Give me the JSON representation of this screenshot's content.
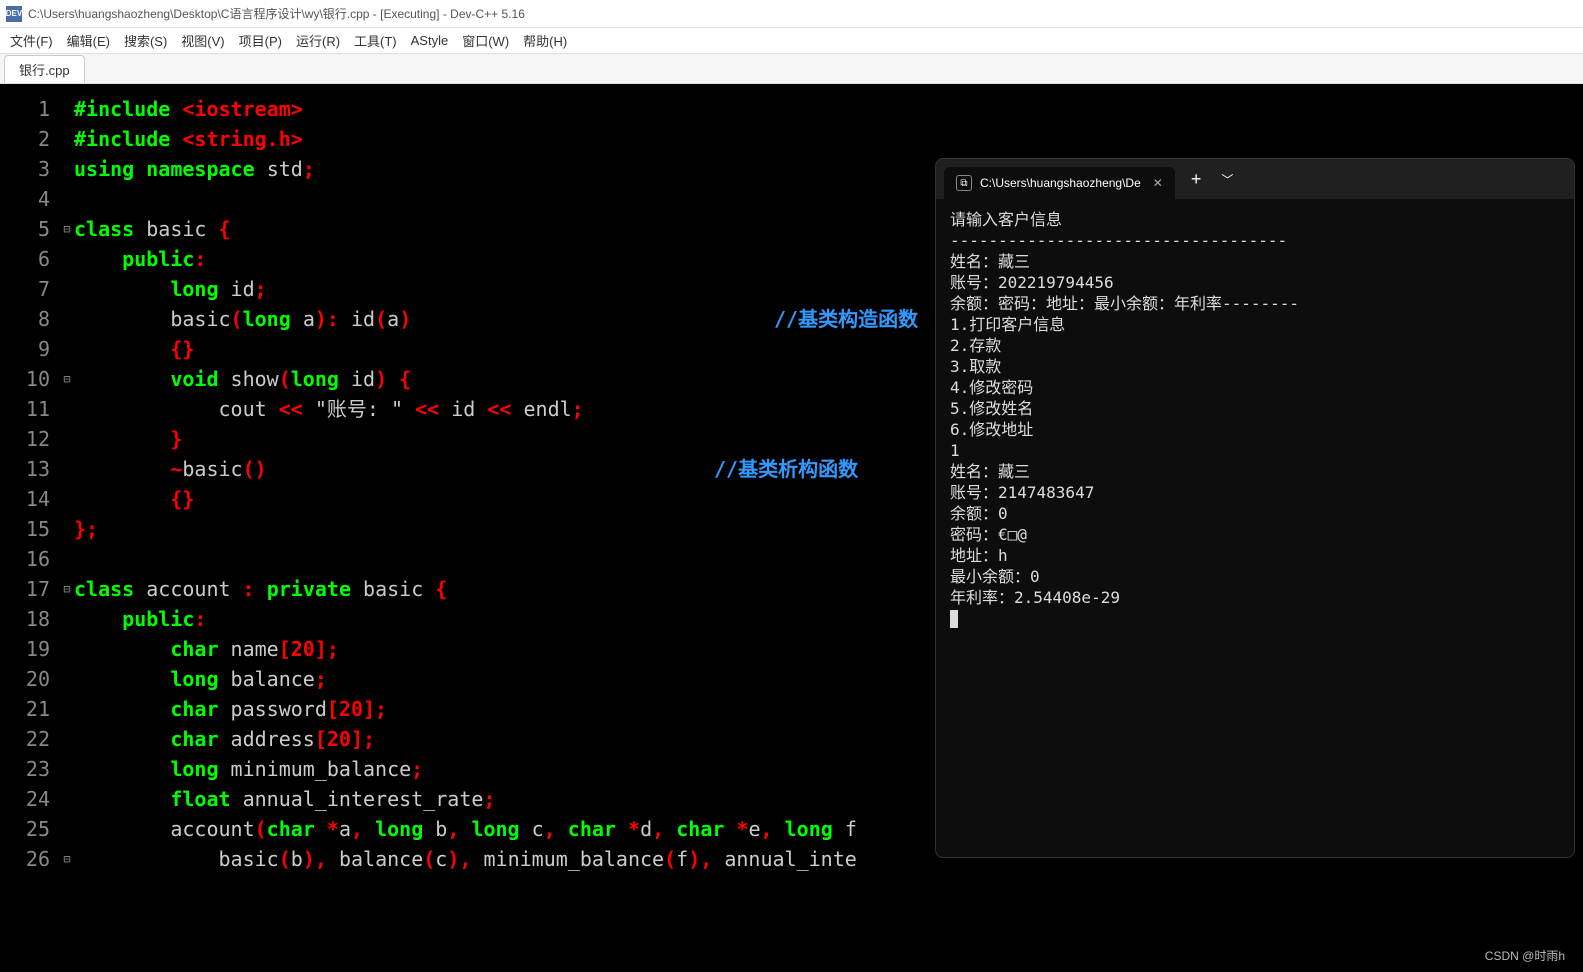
{
  "window": {
    "title": "C:\\Users\\huangshaozheng\\Desktop\\C语言程序设计\\wy\\银行.cpp - [Executing] - Dev-C++ 5.16",
    "app_icon_text": "DEV"
  },
  "menu": {
    "file": "文件(F)",
    "edit": "编辑(E)",
    "search": "搜索(S)",
    "view": "视图(V)",
    "project": "项目(P)",
    "run": "运行(R)",
    "tools": "工具(T)",
    "astyle": "AStyle",
    "window": "窗口(W)",
    "help": "帮助(H)"
  },
  "tab": {
    "label": "银行.cpp"
  },
  "code": {
    "lines": [
      {
        "n": 1,
        "fold": "",
        "html": "<span class='pp'>#include</span> <span class='incl'>&lt;iostream&gt;</span>"
      },
      {
        "n": 2,
        "fold": "",
        "html": "<span class='pp'>#include</span> <span class='incl'>&lt;string.h&gt;</span>"
      },
      {
        "n": 3,
        "fold": "",
        "html": "<span class='kw'>using</span> <span class='kw'>namespace</span> <span class='ident'>std</span><span class='punct'>;</span>"
      },
      {
        "n": 4,
        "fold": "",
        "html": ""
      },
      {
        "n": 5,
        "fold": "⊟",
        "html": "<span class='kw'>class</span> <span class='ident'>basic</span> <span class='punct'>{</span>"
      },
      {
        "n": 6,
        "fold": "",
        "html": "    <span class='kw'>public</span><span class='punct'>:</span>"
      },
      {
        "n": 7,
        "fold": "",
        "html": "        <span class='type'>long</span> <span class='ident'>id</span><span class='punct'>;</span>"
      },
      {
        "n": 8,
        "fold": "",
        "html": "        <span class='func'>basic</span><span class='punct'>(</span><span class='type'>long</span> <span class='ident'>a</span><span class='punct'>):</span> <span class='ident'>id</span><span class='punct'>(</span><span class='ident'>a</span><span class='punct'>)</span>",
        "cmt": "//基类构造函数",
        "cmtx": 700
      },
      {
        "n": 9,
        "fold": "",
        "html": "        <span class='punct'>{}</span>"
      },
      {
        "n": 10,
        "fold": "⊟",
        "html": "        <span class='type'>void</span> <span class='func'>show</span><span class='punct'>(</span><span class='type'>long</span> <span class='ident'>id</span><span class='punct'>)</span> <span class='punct'>{</span>"
      },
      {
        "n": 11,
        "fold": "",
        "html": "            <span class='ident'>cout</span> <span class='op'>&lt;&lt;</span> <span class='str'>\"账号: \"</span> <span class='op'>&lt;&lt;</span> <span class='ident'>id</span> <span class='op'>&lt;&lt;</span> <span class='ident'>endl</span><span class='punct'>;</span>"
      },
      {
        "n": 12,
        "fold": "",
        "html": "        <span class='punct'>}</span>"
      },
      {
        "n": 13,
        "fold": "",
        "html": "        <span class='punct'>~</span><span class='func'>basic</span><span class='punct'>()</span>",
        "cmt": "//基类析构函数",
        "cmtx": 640
      },
      {
        "n": 14,
        "fold": "",
        "html": "        <span class='punct'>{}</span>"
      },
      {
        "n": 15,
        "fold": "",
        "html": "<span class='punct'>};</span>"
      },
      {
        "n": 16,
        "fold": "",
        "html": ""
      },
      {
        "n": 17,
        "fold": "⊟",
        "html": "<span class='kw'>class</span> <span class='ident'>account</span> <span class='punct'>:</span> <span class='kw'>private</span> <span class='ident'>basic</span> <span class='punct'>{</span>"
      },
      {
        "n": 18,
        "fold": "",
        "html": "    <span class='kw'>public</span><span class='punct'>:</span>"
      },
      {
        "n": 19,
        "fold": "",
        "html": "        <span class='type'>char</span> <span class='ident'>name</span><span class='punct'>[</span><span class='num'>20</span><span class='punct'>];</span>"
      },
      {
        "n": 20,
        "fold": "",
        "html": "        <span class='type'>long</span> <span class='ident'>balance</span><span class='punct'>;</span>"
      },
      {
        "n": 21,
        "fold": "",
        "html": "        <span class='type'>char</span> <span class='ident'>password</span><span class='punct'>[</span><span class='num'>20</span><span class='punct'>];</span>"
      },
      {
        "n": 22,
        "fold": "",
        "html": "        <span class='type'>char</span> <span class='ident'>address</span><span class='punct'>[</span><span class='num'>20</span><span class='punct'>];</span>"
      },
      {
        "n": 23,
        "fold": "",
        "html": "        <span class='type'>long</span> <span class='ident'>minimum_balance</span><span class='punct'>;</span>"
      },
      {
        "n": 24,
        "fold": "",
        "html": "        <span class='type'>float</span> <span class='ident'>annual_interest_rate</span><span class='punct'>;</span>"
      },
      {
        "n": 25,
        "fold": "",
        "html": "        <span class='func'>account</span><span class='punct'>(</span><span class='type'>char</span> <span class='op'>*</span><span class='ident'>a</span><span class='punct'>,</span> <span class='type'>long</span> <span class='ident'>b</span><span class='punct'>,</span> <span class='type'>long</span> <span class='ident'>c</span><span class='punct'>,</span> <span class='type'>char</span> <span class='op'>*</span><span class='ident'>d</span><span class='punct'>,</span> <span class='type'>char</span> <span class='op'>*</span><span class='ident'>e</span><span class='punct'>,</span> <span class='type'>long</span> <span class='ident'>f</span>"
      },
      {
        "n": 26,
        "fold": "⊟",
        "html": "            <span class='func'>basic</span><span class='punct'>(</span><span class='ident'>b</span><span class='punct'>),</span> <span class='ident'>balance</span><span class='punct'>(</span><span class='ident'>c</span><span class='punct'>),</span> <span class='ident'>minimum_balance</span><span class='punct'>(</span><span class='ident'>f</span><span class='punct'>),</span> <span class='ident'>annual_inte</span>"
      }
    ]
  },
  "console": {
    "tab_title": "C:\\Users\\huangshaozheng\\De",
    "output": "请输入客户信息\n-----------------------------------\n姓名：藏三\n账号：202219794456\n余额：密码：地址：最小余额：年利率--------\n1.打印客户信息\n2.存款\n3.取款\n4.修改密码\n5.修改姓名\n6.修改地址\n1\n姓名：藏三\n账号：2147483647\n余额：0\n密码：€□@\n地址：h\n最小余额：0\n年利率：2.54408e-29"
  },
  "watermark": "CSDN @时雨h"
}
